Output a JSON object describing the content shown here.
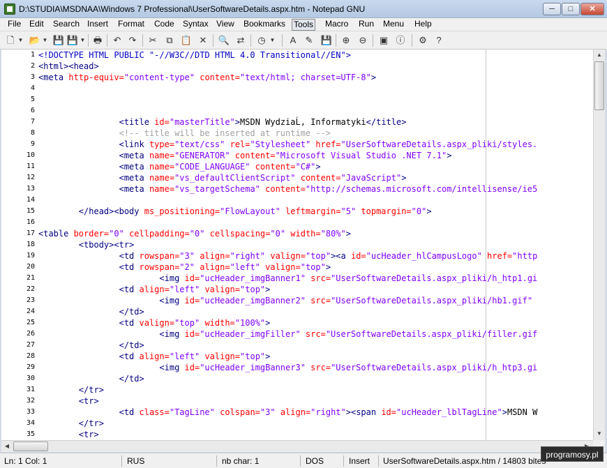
{
  "window": {
    "title": "D:\\STUDIA\\MSDNAA\\Windows 7 Professional\\UserSoftwareDetails.aspx.htm - Notepad GNU",
    "min_glyph": "─",
    "max_glyph": "□",
    "close_glyph": "✕"
  },
  "menu": [
    "File",
    "Edit",
    "Search",
    "Insert",
    "Format",
    "Code",
    "Syntax",
    "View",
    "Bookmarks",
    "Tools",
    "Macro",
    "Run",
    "Menu",
    "Help"
  ],
  "toolbar": {
    "icons": [
      "new-file-icon",
      "open-folder-icon",
      "save-icon",
      "print-icon",
      "undo-icon",
      "redo-icon",
      "cut-icon",
      "copy-icon",
      "paste-icon",
      "delete-icon",
      "find-icon",
      "replace-icon",
      "clock-icon",
      "font-icon",
      "highlight-icon",
      "zoom-in-icon",
      "zoom-out-icon",
      "run-icon",
      "browser-icon",
      "info-icon",
      "settings-icon",
      "help-icon"
    ],
    "glyphs": [
      "🗋",
      "📂",
      "💾",
      "🖶",
      "↶",
      "↷",
      "✂",
      "⧉",
      "📋",
      "✕",
      "🔍",
      "⇄",
      "◷",
      "A",
      "✎",
      "⊕",
      "⊖",
      "▣",
      "◩",
      "ⓘ",
      "⚙",
      "?"
    ]
  },
  "editor": {
    "lines": [
      {
        "n": "1",
        "segs": [
          {
            "t": "<!DOCTYPE HTML PUBLIC \"-//W3C//DTD HTML 4.0 Transitional//EN\">",
            "c": "d"
          }
        ]
      },
      {
        "n": "2",
        "segs": [
          {
            "t": "<html><head>",
            "c": "t"
          }
        ]
      },
      {
        "n": "3",
        "segs": [
          {
            "t": "<meta ",
            "c": "t"
          },
          {
            "t": "http-equiv=",
            "c": "a"
          },
          {
            "t": "\"content-type\" ",
            "c": "v"
          },
          {
            "t": "content=",
            "c": "a"
          },
          {
            "t": "\"text/html; charset=UTF-8\"",
            "c": "v"
          },
          {
            "t": ">",
            "c": "t"
          }
        ]
      },
      {
        "n": "4",
        "segs": []
      },
      {
        "n": "5",
        "segs": []
      },
      {
        "n": "6",
        "segs": []
      },
      {
        "n": "7",
        "segs": [
          {
            "t": "                <title ",
            "c": "t"
          },
          {
            "t": "id=",
            "c": "a"
          },
          {
            "t": "\"masterTitle\"",
            "c": "v"
          },
          {
            "t": ">",
            "c": "t"
          },
          {
            "t": "MSDN WydziaĹ‚ Informatyki",
            "c": "p"
          },
          {
            "t": "</title>",
            "c": "t"
          }
        ]
      },
      {
        "n": "8",
        "segs": [
          {
            "t": "                <!-- title will be inserted at runtime -->",
            "c": "c"
          }
        ]
      },
      {
        "n": "9",
        "segs": [
          {
            "t": "                <link ",
            "c": "t"
          },
          {
            "t": "type=",
            "c": "a"
          },
          {
            "t": "\"text/css\" ",
            "c": "v"
          },
          {
            "t": "rel=",
            "c": "a"
          },
          {
            "t": "\"Stylesheet\" ",
            "c": "v"
          },
          {
            "t": "href=",
            "c": "a"
          },
          {
            "t": "\"UserSoftwareDetails.aspx_pliki/styles.",
            "c": "v"
          }
        ]
      },
      {
        "n": "10",
        "segs": [
          {
            "t": "                <meta ",
            "c": "t"
          },
          {
            "t": "name=",
            "c": "a"
          },
          {
            "t": "\"GENERATOR\" ",
            "c": "v"
          },
          {
            "t": "content=",
            "c": "a"
          },
          {
            "t": "\"Microsoft Visual Studio .NET 7.1\"",
            "c": "v"
          },
          {
            "t": ">",
            "c": "t"
          }
        ]
      },
      {
        "n": "11",
        "segs": [
          {
            "t": "                <meta ",
            "c": "t"
          },
          {
            "t": "name=",
            "c": "a"
          },
          {
            "t": "\"CODE_LANGUAGE\" ",
            "c": "v"
          },
          {
            "t": "content=",
            "c": "a"
          },
          {
            "t": "\"C#\"",
            "c": "v"
          },
          {
            "t": ">",
            "c": "t"
          }
        ]
      },
      {
        "n": "12",
        "segs": [
          {
            "t": "                <meta ",
            "c": "t"
          },
          {
            "t": "name=",
            "c": "a"
          },
          {
            "t": "\"vs_defaultClientScript\" ",
            "c": "v"
          },
          {
            "t": "content=",
            "c": "a"
          },
          {
            "t": "\"JavaScript\"",
            "c": "v"
          },
          {
            "t": ">",
            "c": "t"
          }
        ]
      },
      {
        "n": "13",
        "segs": [
          {
            "t": "                <meta ",
            "c": "t"
          },
          {
            "t": "name=",
            "c": "a"
          },
          {
            "t": "\"vs_targetSchema\" ",
            "c": "v"
          },
          {
            "t": "content=",
            "c": "a"
          },
          {
            "t": "\"http://schemas.microsoft.com/intellisense/ie5",
            "c": "v"
          }
        ]
      },
      {
        "n": "14",
        "segs": []
      },
      {
        "n": "15",
        "segs": [
          {
            "t": "        </head><body ",
            "c": "t"
          },
          {
            "t": "ms_positioning=",
            "c": "a"
          },
          {
            "t": "\"FlowLayout\" ",
            "c": "v"
          },
          {
            "t": "leftmargin=",
            "c": "a"
          },
          {
            "t": "\"5\" ",
            "c": "v"
          },
          {
            "t": "topmargin=",
            "c": "a"
          },
          {
            "t": "\"0\"",
            "c": "v"
          },
          {
            "t": ">",
            "c": "t"
          }
        ]
      },
      {
        "n": "16",
        "segs": []
      },
      {
        "n": "17",
        "segs": [
          {
            "t": "<table ",
            "c": "t"
          },
          {
            "t": "border=",
            "c": "a"
          },
          {
            "t": "\"0\" ",
            "c": "v"
          },
          {
            "t": "cellpadding=",
            "c": "a"
          },
          {
            "t": "\"0\" ",
            "c": "v"
          },
          {
            "t": "cellspacing=",
            "c": "a"
          },
          {
            "t": "\"0\" ",
            "c": "v"
          },
          {
            "t": "width=",
            "c": "a"
          },
          {
            "t": "\"80%\"",
            "c": "v"
          },
          {
            "t": ">",
            "c": "t"
          }
        ]
      },
      {
        "n": "18",
        "segs": [
          {
            "t": "        <tbody><tr>",
            "c": "t"
          }
        ]
      },
      {
        "n": "19",
        "segs": [
          {
            "t": "                <td ",
            "c": "t"
          },
          {
            "t": "rowspan=",
            "c": "a"
          },
          {
            "t": "\"3\" ",
            "c": "v"
          },
          {
            "t": "align=",
            "c": "a"
          },
          {
            "t": "\"right\" ",
            "c": "v"
          },
          {
            "t": "valign=",
            "c": "a"
          },
          {
            "t": "\"top\"",
            "c": "v"
          },
          {
            "t": "><a ",
            "c": "t"
          },
          {
            "t": "id=",
            "c": "a"
          },
          {
            "t": "\"ucHeader_hlCampusLogo\" ",
            "c": "v"
          },
          {
            "t": "href=",
            "c": "a"
          },
          {
            "t": "\"http",
            "c": "v"
          }
        ]
      },
      {
        "n": "20",
        "segs": [
          {
            "t": "                <td ",
            "c": "t"
          },
          {
            "t": "rowspan=",
            "c": "a"
          },
          {
            "t": "\"2\" ",
            "c": "v"
          },
          {
            "t": "align=",
            "c": "a"
          },
          {
            "t": "\"left\" ",
            "c": "v"
          },
          {
            "t": "valign=",
            "c": "a"
          },
          {
            "t": "\"top\"",
            "c": "v"
          },
          {
            "t": ">",
            "c": "t"
          }
        ]
      },
      {
        "n": "21",
        "segs": [
          {
            "t": "                        <img ",
            "c": "t"
          },
          {
            "t": "id=",
            "c": "a"
          },
          {
            "t": "\"ucHeader_imgBanner1\" ",
            "c": "v"
          },
          {
            "t": "src=",
            "c": "a"
          },
          {
            "t": "\"UserSoftwareDetails.aspx_pliki/h_htp1.gi",
            "c": "v"
          }
        ]
      },
      {
        "n": "22",
        "segs": [
          {
            "t": "                <td ",
            "c": "t"
          },
          {
            "t": "align=",
            "c": "a"
          },
          {
            "t": "\"left\" ",
            "c": "v"
          },
          {
            "t": "valign=",
            "c": "a"
          },
          {
            "t": "\"top\"",
            "c": "v"
          },
          {
            "t": ">",
            "c": "t"
          }
        ]
      },
      {
        "n": "23",
        "segs": [
          {
            "t": "                        <img ",
            "c": "t"
          },
          {
            "t": "id=",
            "c": "a"
          },
          {
            "t": "\"ucHeader_imgBanner2\" ",
            "c": "v"
          },
          {
            "t": "src=",
            "c": "a"
          },
          {
            "t": "\"UserSoftwareDetails.aspx_pliki/hb1.gif\" ",
            "c": "v"
          }
        ]
      },
      {
        "n": "24",
        "segs": [
          {
            "t": "                </td>",
            "c": "t"
          }
        ]
      },
      {
        "n": "25",
        "segs": [
          {
            "t": "                <td ",
            "c": "t"
          },
          {
            "t": "valign=",
            "c": "a"
          },
          {
            "t": "\"top\" ",
            "c": "v"
          },
          {
            "t": "width=",
            "c": "a"
          },
          {
            "t": "\"100%\"",
            "c": "v"
          },
          {
            "t": ">",
            "c": "t"
          }
        ]
      },
      {
        "n": "26",
        "segs": [
          {
            "t": "                        <img ",
            "c": "t"
          },
          {
            "t": "id=",
            "c": "a"
          },
          {
            "t": "\"ucHeader_imgFiller\" ",
            "c": "v"
          },
          {
            "t": "src=",
            "c": "a"
          },
          {
            "t": "\"UserSoftwareDetails.aspx_pliki/filler.gif",
            "c": "v"
          }
        ]
      },
      {
        "n": "27",
        "segs": [
          {
            "t": "                </td>",
            "c": "t"
          }
        ]
      },
      {
        "n": "28",
        "segs": [
          {
            "t": "                <td ",
            "c": "t"
          },
          {
            "t": "align=",
            "c": "a"
          },
          {
            "t": "\"left\" ",
            "c": "v"
          },
          {
            "t": "valign=",
            "c": "a"
          },
          {
            "t": "\"top\"",
            "c": "v"
          },
          {
            "t": ">",
            "c": "t"
          }
        ]
      },
      {
        "n": "29",
        "segs": [
          {
            "t": "                        <img ",
            "c": "t"
          },
          {
            "t": "id=",
            "c": "a"
          },
          {
            "t": "\"ucHeader_imgBanner3\" ",
            "c": "v"
          },
          {
            "t": "src=",
            "c": "a"
          },
          {
            "t": "\"UserSoftwareDetails.aspx_pliki/h_htp3.gi",
            "c": "v"
          }
        ]
      },
      {
        "n": "30",
        "segs": [
          {
            "t": "                </td>",
            "c": "t"
          }
        ]
      },
      {
        "n": "31",
        "segs": [
          {
            "t": "        </tr>",
            "c": "t"
          }
        ]
      },
      {
        "n": "32",
        "segs": [
          {
            "t": "        <tr>",
            "c": "t"
          }
        ]
      },
      {
        "n": "33",
        "segs": [
          {
            "t": "                <td ",
            "c": "t"
          },
          {
            "t": "class=",
            "c": "a"
          },
          {
            "t": "\"TagLine\" ",
            "c": "v"
          },
          {
            "t": "colspan=",
            "c": "a"
          },
          {
            "t": "\"3\" ",
            "c": "v"
          },
          {
            "t": "align=",
            "c": "a"
          },
          {
            "t": "\"right\"",
            "c": "v"
          },
          {
            "t": "><span ",
            "c": "t"
          },
          {
            "t": "id=",
            "c": "a"
          },
          {
            "t": "\"ucHeader_lblTagLine\"",
            "c": "v"
          },
          {
            "t": ">",
            "c": "t"
          },
          {
            "t": "MSDN W",
            "c": "p"
          }
        ]
      },
      {
        "n": "34",
        "segs": [
          {
            "t": "        </tr>",
            "c": "t"
          }
        ]
      },
      {
        "n": "35",
        "segs": [
          {
            "t": "        <tr>",
            "c": "t"
          }
        ]
      }
    ]
  },
  "statusbar": {
    "position": "Ln: 1 Col: 1",
    "language": "RUS",
    "chars": "nb char: 1",
    "eol": "DOS",
    "mode": "Insert",
    "file": "UserSoftwareDetails.aspx.htm / 14803 bites"
  },
  "watermark": "programosy.pl"
}
